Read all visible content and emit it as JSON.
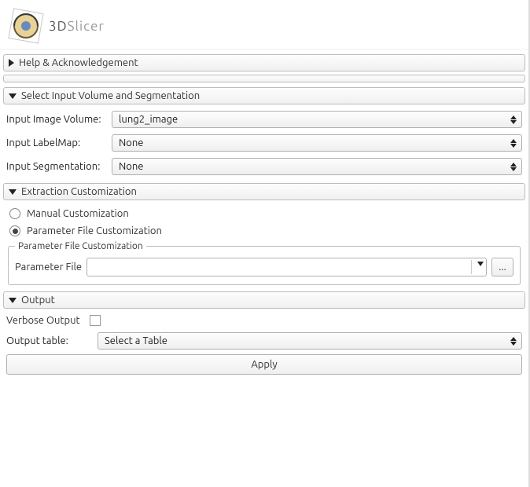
{
  "app": {
    "title_prefix": "3D",
    "title_rest": "Slicer"
  },
  "sections": {
    "help": "Help & Acknowledgement",
    "input": "Select Input Volume and Segmentation",
    "extraction": "Extraction Customization",
    "output": "Output"
  },
  "inputs": {
    "image_label": "Input Image Volume:",
    "image_value": "lung2_image",
    "labelmap_label": "Input LabelMap:",
    "labelmap_value": "None",
    "segmentation_label": "Input Segmentation:",
    "segmentation_value": "None"
  },
  "extraction": {
    "manual_label": "Manual Customization",
    "paramfile_label": "Parameter File Customization",
    "selected": "paramfile",
    "group_title": "Parameter File Customization",
    "pf_label": "Parameter File",
    "pf_value": "",
    "browse_symbol": "..."
  },
  "output": {
    "verbose_label": "Verbose Output",
    "verbose_checked": false,
    "table_label": "Output table:",
    "table_value": "Select a Table"
  },
  "buttons": {
    "apply": "Apply"
  }
}
